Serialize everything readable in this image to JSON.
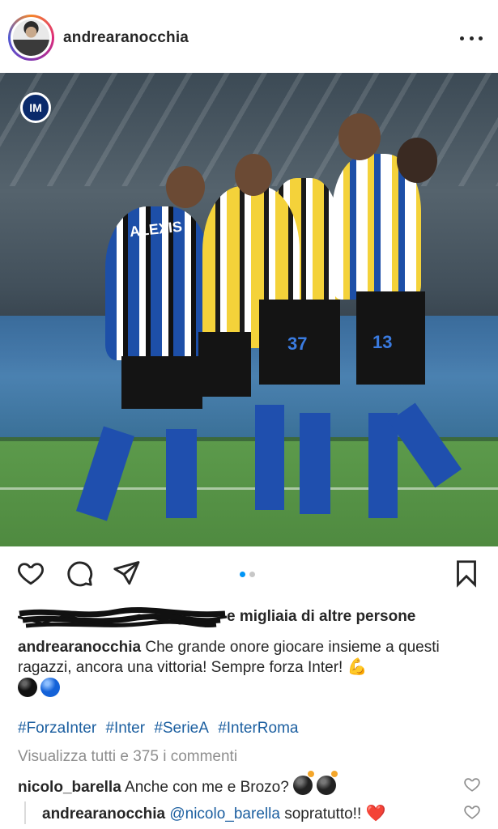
{
  "header": {
    "username": "andrearanocchia",
    "more_icon": "more-horizontal-icon"
  },
  "photo": {
    "club_badge": "IM",
    "shirt_name": "ALEXIS",
    "numbers": [
      "37",
      "13"
    ]
  },
  "actions": {
    "icons": [
      "heart-icon",
      "comment-icon",
      "share-icon",
      "bookmark-icon"
    ],
    "carousel_count": 2,
    "carousel_active_index": 0
  },
  "likes": {
    "text": "e migliaia di altre persone"
  },
  "caption": {
    "user": "andrearanocchia",
    "text": "Che grande onore giocare insieme a questi ragazzi, ancora una vittoria! Sempre forza Inter!",
    "emoji": "💪"
  },
  "hashtags": [
    "#ForzaInter",
    "#Inter",
    "#SerieA",
    "#InterRoma"
  ],
  "view_comments": "Visualizza tutti e 375 i commenti",
  "comments": [
    {
      "user": "nicolo_barella",
      "text": "Anche con me e Brozo?"
    },
    {
      "user": "andrearanocchia",
      "mention": "@nicolo_barella",
      "text": "sopratutto!!",
      "emoji": "❤️"
    }
  ],
  "colors": {
    "link": "#1c5fa0",
    "carousel_active": "#0095f6",
    "muted": "#8e8e8e",
    "text": "#262626"
  }
}
